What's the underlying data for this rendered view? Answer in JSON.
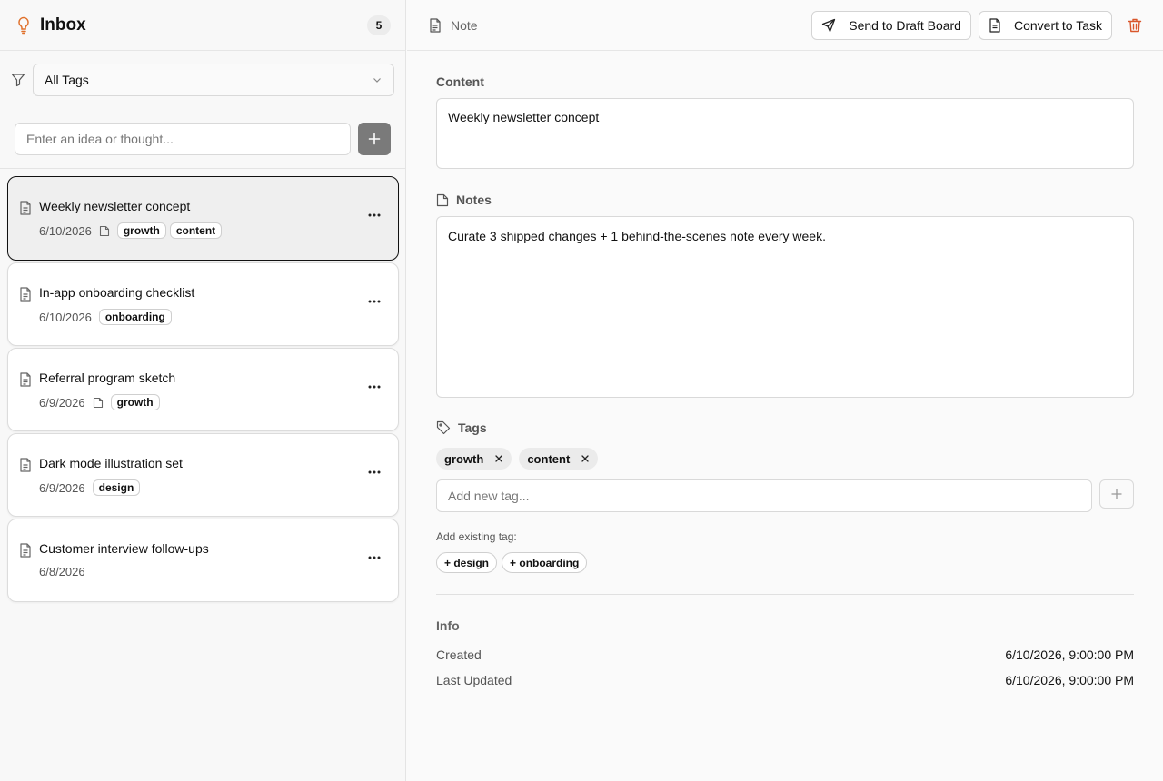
{
  "sidebar": {
    "title": "Inbox",
    "count": "5",
    "filter": {
      "selected": "All Tags"
    },
    "new_idea": {
      "placeholder": "Enter an idea or thought..."
    },
    "items": [
      {
        "title": "Weekly newsletter concept",
        "date": "6/10/2026",
        "has_notes": true,
        "tags": [
          "growth",
          "content"
        ],
        "active": true
      },
      {
        "title": "In-app onboarding checklist",
        "date": "6/10/2026",
        "has_notes": false,
        "tags": [
          "onboarding"
        ],
        "active": false
      },
      {
        "title": "Referral program sketch",
        "date": "6/9/2026",
        "has_notes": true,
        "tags": [
          "growth"
        ],
        "active": false
      },
      {
        "title": "Dark mode illustration set",
        "date": "6/9/2026",
        "has_notes": false,
        "tags": [
          "design"
        ],
        "active": false
      },
      {
        "title": "Customer interview follow-ups",
        "date": "6/8/2026",
        "has_notes": false,
        "tags": [],
        "active": false
      }
    ]
  },
  "detail": {
    "type_label": "Note",
    "send_label": "Send to Draft Board",
    "convert_label": "Convert to Task",
    "content_label": "Content",
    "content_value": "Weekly newsletter concept",
    "notes_label": "Notes",
    "notes_value": "Curate 3 shipped changes + 1 behind-the-scenes note every week.",
    "tags_label": "Tags",
    "tags": [
      "growth",
      "content"
    ],
    "new_tag_placeholder": "Add new tag...",
    "existing_label": "Add existing tag:",
    "existing_tags": [
      "+ design",
      "+ onboarding"
    ],
    "info_label": "Info",
    "created_label": "Created",
    "created_value": "6/10/2026, 9:00:00 PM",
    "updated_label": "Last Updated",
    "updated_value": "6/10/2026, 9:00:00 PM"
  },
  "colors": {
    "accent": "#e0702a",
    "danger": "#d9562b",
    "add_button": "#7a7a7a"
  }
}
